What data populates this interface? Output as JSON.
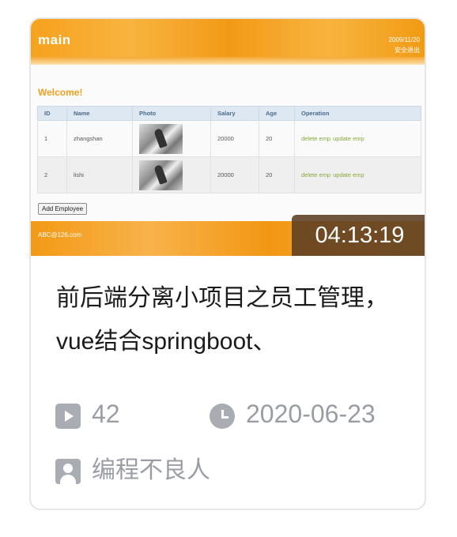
{
  "thumbnail": {
    "brand": "main",
    "date": "2009/11/20",
    "logout": "安全退出",
    "welcome": "Welcome!",
    "table": {
      "headers": [
        "ID",
        "Name",
        "Photo",
        "Salary",
        "Age",
        "Operation"
      ],
      "rows": [
        {
          "id": "1",
          "name": "zhangshan",
          "salary": "20000",
          "age": "20",
          "delete": "delete emp",
          "update": "update emp"
        },
        {
          "id": "2",
          "name": "lishi",
          "salary": "20000",
          "age": "20",
          "delete": "delete emp",
          "update": "update emp"
        }
      ]
    },
    "add_button": "Add Employee",
    "footer_email": "ABC@126.com"
  },
  "duration": "04:13:19",
  "title": "前后端分离小项目之员工管理，vue结合springboot、",
  "meta": {
    "views": "42",
    "date": "2020-06-23",
    "author": "编程不良人"
  },
  "icons": {
    "views": "play-icon",
    "date": "clock-icon",
    "author": "user-icon"
  },
  "colors": {
    "banner_orange": "#f6a21d",
    "welcome": "#f29f1f",
    "duration_bg": "#5c3e22",
    "meta_gray": "#9a9ea4"
  }
}
